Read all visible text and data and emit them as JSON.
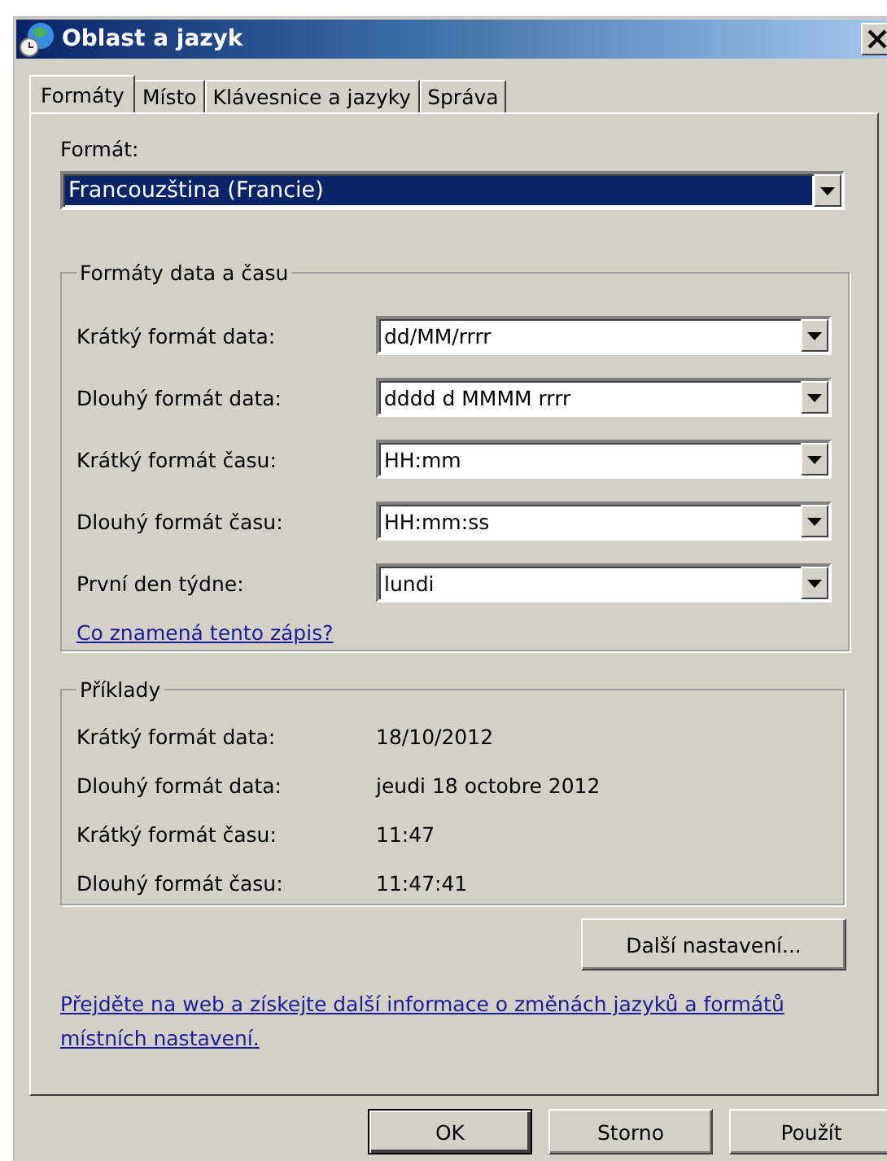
{
  "window": {
    "title": "Oblast a jazyk"
  },
  "tabs": [
    {
      "label": "Formáty",
      "selected": true
    },
    {
      "label": "Místo",
      "selected": false
    },
    {
      "label": "Klávesnice a jazyky",
      "selected": false
    },
    {
      "label": "Správa",
      "selected": false
    }
  ],
  "format": {
    "label": "Formát:",
    "value": "Francouzština (Francie)"
  },
  "date_time_formats": {
    "title": "Formáty data a času",
    "rows": [
      {
        "label": "Krátký formát data:",
        "value": "dd/MM/rrrr"
      },
      {
        "label": "Dlouhý formát data:",
        "value": "dddd d MMMM rrrr"
      },
      {
        "label": "Krátký formát času:",
        "value": "HH:mm"
      },
      {
        "label": "Dlouhý formát času:",
        "value": "HH:mm:ss"
      },
      {
        "label": "První den týdne:",
        "value": "lundi"
      }
    ],
    "link": "Co znamená tento zápis?"
  },
  "examples": {
    "title": "Příklady",
    "rows": [
      {
        "label": "Krátký formát data:",
        "value": "18/10/2012"
      },
      {
        "label": "Dlouhý formát data:",
        "value": "jeudi 18 octobre 2012"
      },
      {
        "label": "Krátký formát času:",
        "value": "11:47"
      },
      {
        "label": "Dlouhý formát času:",
        "value": "11:47:41"
      }
    ]
  },
  "more_button": "Další nastavení...",
  "info_link": "Přejděte na web a získejte další informace o změnách jazyků a formátů místních nastavení.",
  "buttons": [
    {
      "label": "OK",
      "default": true
    },
    {
      "label": "Storno",
      "default": false
    },
    {
      "label": "Použít",
      "default": false
    }
  ]
}
